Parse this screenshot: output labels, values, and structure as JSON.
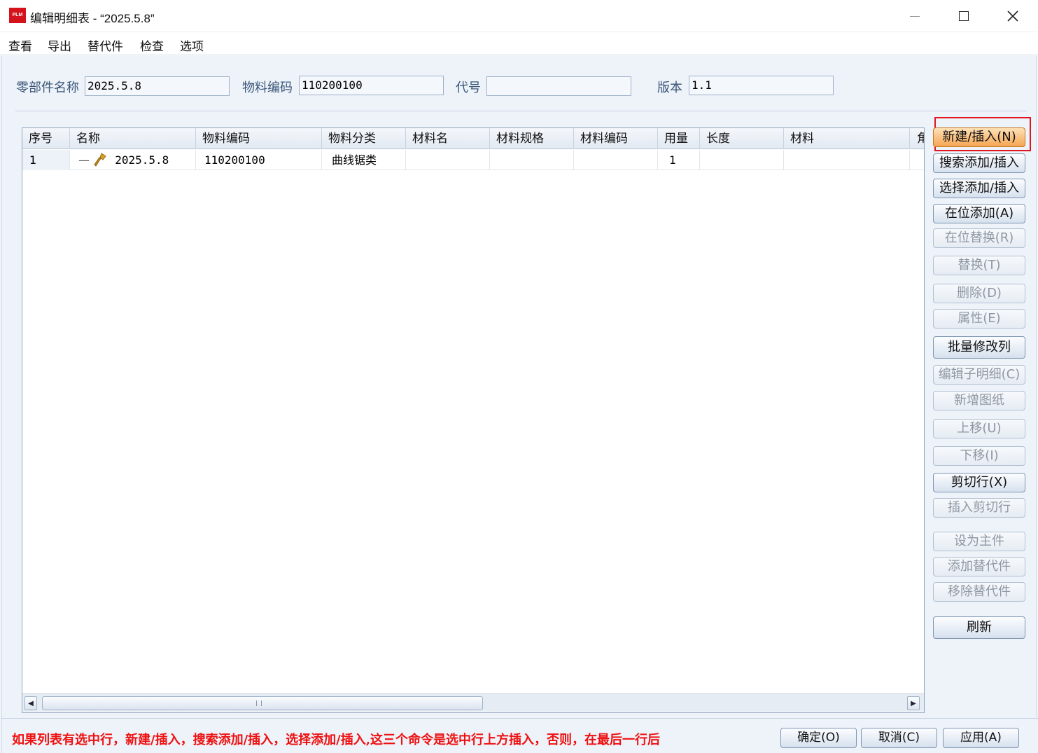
{
  "window": {
    "logo_text": "PLM",
    "title": "编辑明细表 - “2025.5.8”"
  },
  "menu": [
    "查看",
    "导出",
    "替代件",
    "检查",
    "选项"
  ],
  "form": {
    "part_name_label": "零部件名称",
    "part_name_value": "2025.5.8",
    "material_code_label": "物料编码",
    "material_code_value": "110200100",
    "code_label": "代号",
    "code_value": "",
    "version_label": "版本",
    "version_value": "1.1"
  },
  "table": {
    "columns": [
      "序号",
      "名称",
      "物料编码",
      "物料分类",
      "材料名",
      "材料规格",
      "材料编码",
      "用量",
      "长度",
      "材料",
      "角"
    ],
    "rows": [
      {
        "seq": "1",
        "tree_prefix": "—",
        "name": "2025.5.8",
        "material_code": "110200100",
        "category": "曲线锯类",
        "material_name": "",
        "material_spec": "",
        "material_no": "",
        "qty": "1",
        "length": "",
        "material": ""
      }
    ]
  },
  "buttons": {
    "new_insert": "新建/插入(N)",
    "search_add": "搜索添加/插入",
    "select_add": "选择添加/插入",
    "inplace_add": "在位添加(A)",
    "inplace_replace": "在位替换(R)",
    "replace": "替换(T)",
    "delete": "删除(D)",
    "properties": "属性(E)",
    "batch_edit": "批量修改列",
    "edit_sub": "编辑子明细(C)",
    "new_drawing": "新增图纸",
    "move_up": "上移(U)",
    "move_down": "下移(I)",
    "cut_row": "剪切行(X)",
    "insert_cut": "插入剪切行",
    "set_main": "设为主件",
    "add_sub": "添加替代件",
    "remove_sub": "移除替代件",
    "refresh": "刷新"
  },
  "bottom": {
    "hint": "如果列表有选中行，新建/插入，搜索添加/插入，选择添加/插入,这三个命令是选中行上方插入，否则，在最后一行后",
    "ok": "确定(O)",
    "cancel": "取消(C)",
    "apply": "应用(A)"
  },
  "colors": {
    "highlight_border": "#e0141c",
    "hint_text": "#ee1111",
    "logo_bg": "#d4121b"
  }
}
